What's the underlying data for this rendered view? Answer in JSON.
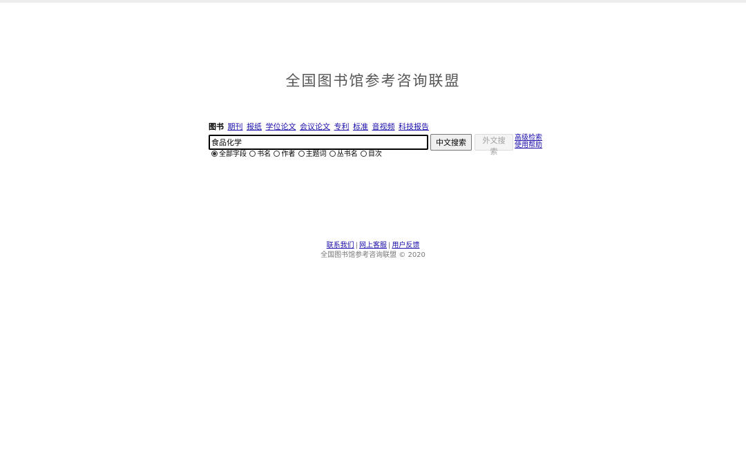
{
  "site_title": "全国图书馆参考咨询联盟",
  "categories": [
    {
      "label": "图书",
      "active": true
    },
    {
      "label": "期刊",
      "active": false
    },
    {
      "label": "报纸",
      "active": false
    },
    {
      "label": "学位论文",
      "active": false
    },
    {
      "label": "会议论文",
      "active": false
    },
    {
      "label": "专利",
      "active": false
    },
    {
      "label": "标准",
      "active": false
    },
    {
      "label": "音视频",
      "active": false
    },
    {
      "label": "科技报告",
      "active": false
    }
  ],
  "search": {
    "value": "食品化学",
    "placeholder": "",
    "chinese_button": "中文搜索",
    "foreign_button": "外文搜索",
    "advanced_link": "高级检索",
    "help_link": "使用帮助"
  },
  "field_options": [
    {
      "label": "全部字段",
      "checked": true
    },
    {
      "label": "书名",
      "checked": false
    },
    {
      "label": "作者",
      "checked": false
    },
    {
      "label": "主题词",
      "checked": false
    },
    {
      "label": "丛书名",
      "checked": false
    },
    {
      "label": "目次",
      "checked": false
    }
  ],
  "footer": {
    "links": [
      "联系我们",
      "网上客服",
      "用户反馈"
    ],
    "separator": "|",
    "copyright": "全国图书馆参考咨询联盟 © 2020"
  },
  "colors": {
    "link": "#1a0dab",
    "title": "#555555",
    "topbar": "#ececec"
  }
}
